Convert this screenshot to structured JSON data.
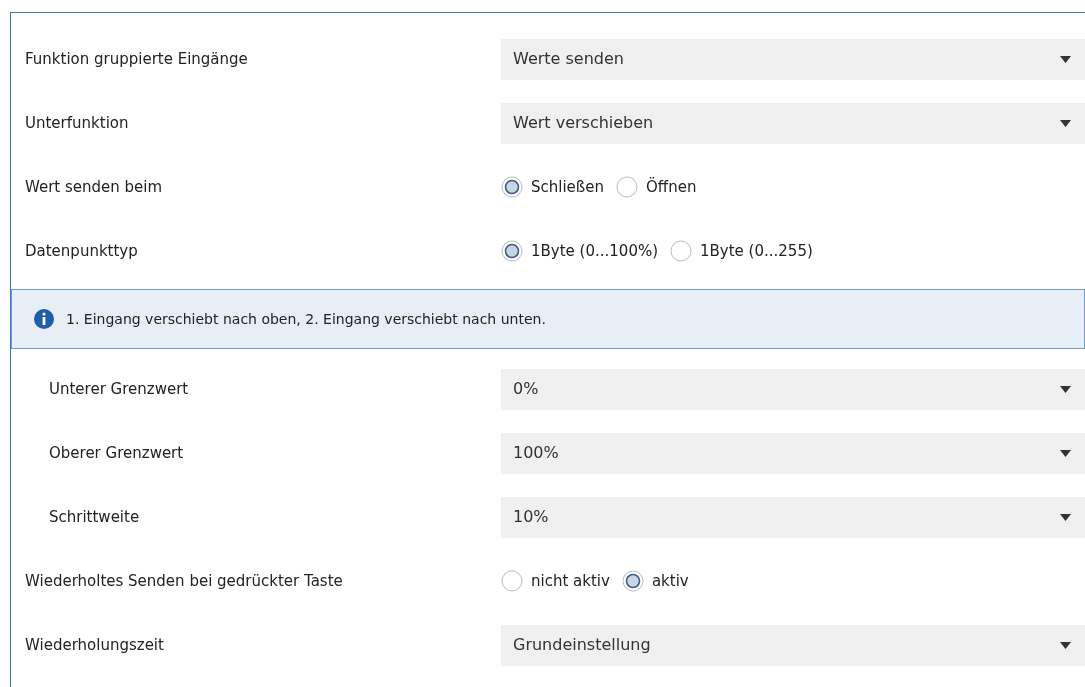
{
  "rows": [
    {
      "kind": "select",
      "label": "Funktion gruppierte Eingänge",
      "value": "Werte senden",
      "indented": false
    },
    {
      "kind": "select",
      "label": "Unterfunktion",
      "value": "Wert verschieben",
      "indented": false
    },
    {
      "kind": "radio",
      "label": "Wert senden beim",
      "options": [
        {
          "label": "Schließen",
          "selected": true
        },
        {
          "label": "Öffnen",
          "selected": false
        }
      ],
      "indented": false
    },
    {
      "kind": "radio",
      "label": "Datenpunkttyp",
      "options": [
        {
          "label": "1Byte (0...100%)",
          "selected": true
        },
        {
          "label": "1Byte (0...255)",
          "selected": false
        }
      ],
      "indented": false
    },
    {
      "kind": "info",
      "text": "1. Eingang verschiebt nach oben, 2. Eingang verschiebt nach unten."
    },
    {
      "kind": "select",
      "label": "Unterer Grenzwert",
      "value": "0%",
      "indented": true
    },
    {
      "kind": "select",
      "label": "Oberer Grenzwert",
      "value": "100%",
      "indented": true
    },
    {
      "kind": "select",
      "label": "Schrittweite",
      "value": "10%",
      "indented": true
    },
    {
      "kind": "radio",
      "label": "Wiederholtes Senden bei gedrückter Taste",
      "options": [
        {
          "label": "nicht aktiv",
          "selected": false
        },
        {
          "label": "aktiv",
          "selected": true
        }
      ],
      "indented": false
    },
    {
      "kind": "select",
      "label": "Wiederholungszeit",
      "value": "Grundeinstellung",
      "indented": false
    }
  ]
}
